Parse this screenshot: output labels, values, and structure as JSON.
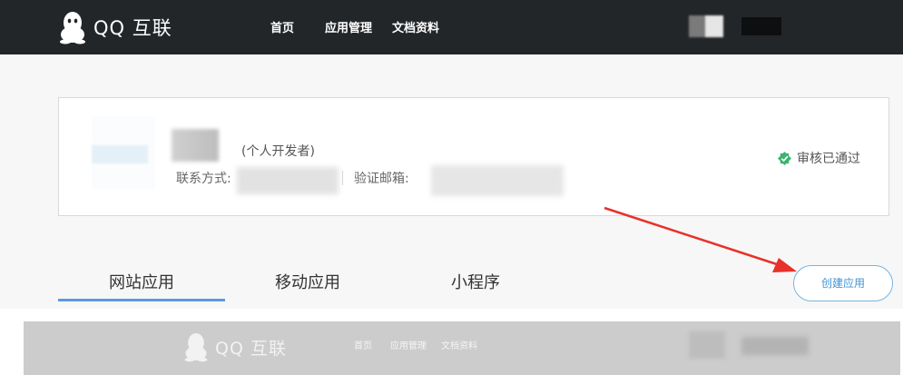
{
  "header": {
    "logo_text": "QQ 互联",
    "nav": [
      {
        "label": "首页"
      },
      {
        "label": "应用管理"
      },
      {
        "label": "文档资料"
      }
    ]
  },
  "developer_card": {
    "developer_type": "(个人开发者)",
    "contact_label": "联系方式:",
    "email_label": "验证邮箱:",
    "status_text": "审核已通过",
    "status_color": "#3cb371"
  },
  "tabs": [
    {
      "label": "网站应用",
      "active": true
    },
    {
      "label": "移动应用",
      "active": false
    },
    {
      "label": "小程序",
      "active": false
    }
  ],
  "actions": {
    "create_app_label": "创建应用"
  },
  "annotation": {
    "arrow_color": "#e8312a"
  },
  "ghost_header": {
    "logo_text": "QQ 互联",
    "nav": [
      {
        "label": "首页"
      },
      {
        "label": "应用管理"
      },
      {
        "label": "文档资料"
      }
    ]
  },
  "colors": {
    "topbar": "#232629",
    "accent": "#5a9bde",
    "button_text": "#3f93d6"
  }
}
